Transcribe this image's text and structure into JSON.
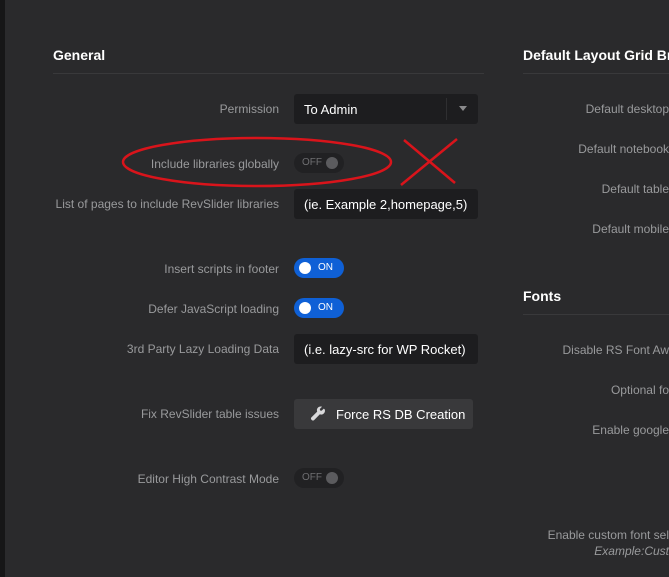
{
  "general": {
    "title": "General",
    "permission": {
      "label": "Permission",
      "value": "To Admin"
    },
    "include_libraries": {
      "label": "Include libraries globally",
      "state": "OFF"
    },
    "pages_list": {
      "label": "List of pages to include RevSlider libraries",
      "value": "(ie. Example 2,homepage,5)"
    },
    "insert_footer": {
      "label": "Insert scripts in footer",
      "state": "ON"
    },
    "defer_js": {
      "label": "Defer JavaScript loading",
      "state": "ON"
    },
    "lazy_loading": {
      "label": "3rd Party Lazy Loading Data",
      "value": "(i.e. lazy-src for WP Rocket)"
    },
    "fix_tables": {
      "label": "Fix RevSlider table issues",
      "button": "Force RS DB Creation",
      "icon": "wrench-icon"
    },
    "high_contrast": {
      "label": "Editor High Contrast Mode",
      "state": "OFF"
    }
  },
  "layout_grid": {
    "title": "Default Layout Grid Br",
    "desktop": "Default desktop",
    "notebook": "Default notebook",
    "tablet": "Default table",
    "mobile": "Default mobile"
  },
  "fonts": {
    "title": "Fonts",
    "disable_awesome": "Disable RS Font Aw",
    "optional": "Optional fo",
    "enable_google": "Enable google",
    "enable_custom": "Enable custom font sel",
    "example": "Example:Cust"
  },
  "annotation": {
    "color": "#d9141b"
  }
}
